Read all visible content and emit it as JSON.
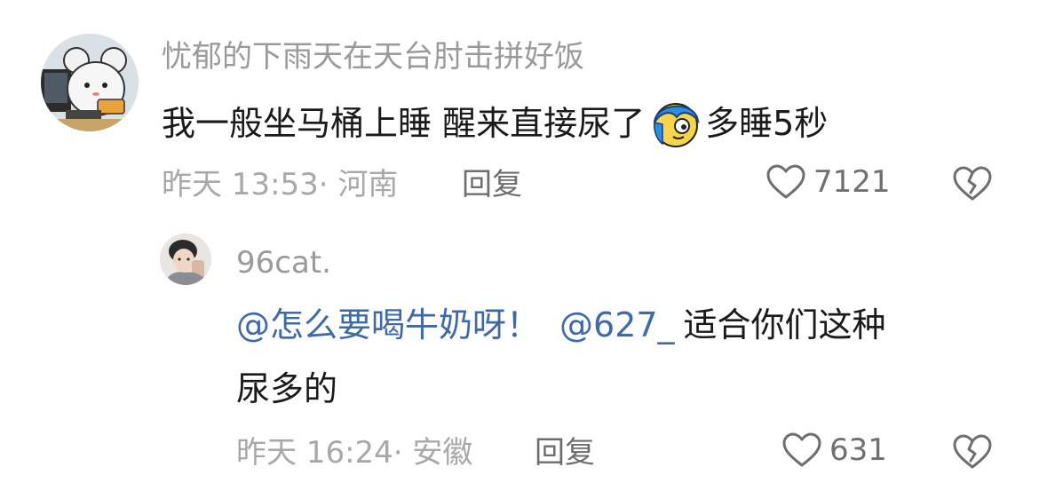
{
  "comment": {
    "username": "忧郁的下雨天在天台肘击拼好饭",
    "avatar_icon": "mouse-at-computer-icon",
    "text_part1": "我一般坐马桶上睡 醒来直接尿了",
    "emoji_icon": "blue-hair-face-emoji-icon",
    "text_part2": "多睡5秒",
    "meta": "昨天 13:53· 河南",
    "reply_label": "回复",
    "like_count": "7121",
    "like_icon": "heart-outline-icon",
    "dislike_icon": "broken-heart-icon"
  },
  "reply": {
    "username": "96cat.",
    "avatar_icon": "person-photo-icon",
    "mention1": "@怎么要喝牛奶呀！",
    "mention2": "@627_",
    "text_line1": "适合你们这种",
    "text_line2": "尿多的",
    "meta": "昨天 16:24· 安徽",
    "reply_label": "回复",
    "like_count": "631",
    "like_icon": "heart-outline-icon",
    "dislike_icon": "broken-heart-icon"
  },
  "colors": {
    "username": "#9a9a9a",
    "text": "#1a1a1a",
    "mention": "#3f6aa8",
    "meta": "#a8a8a8"
  }
}
